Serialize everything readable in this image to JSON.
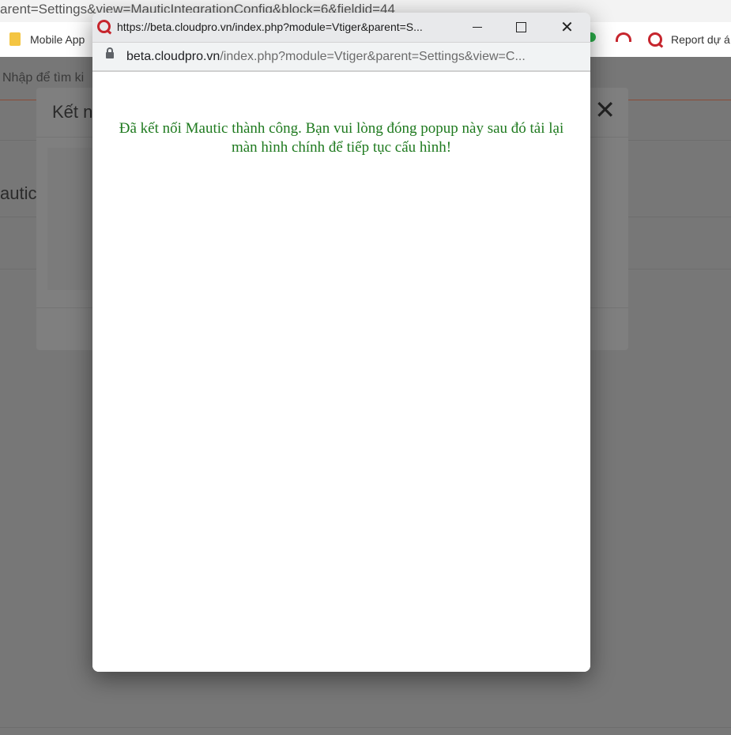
{
  "background": {
    "url_bar_text": "arent=Settings&view=MauticIntegrationConfig&block=6&fieldid=44",
    "bookmarks": [
      {
        "label": "Mobile App"
      },
      {
        "label": "Report dự á"
      }
    ],
    "search_placeholder": "Nhập để tìm ki",
    "modal_title": "Kết n",
    "modal_close": "✕",
    "page_heading": "autic"
  },
  "popup": {
    "window_title": "https://beta.cloudpro.vn/index.php?module=Vtiger&parent=S...",
    "address_domain": "beta.cloudpro.vn",
    "address_path": "/index.php?module=Vtiger&parent=Settings&view=C...",
    "close_glyph": "✕",
    "message": "Đã kết nối Mautic thành công. Bạn vui lòng đóng popup này sau đó tải lại màn hình chính để tiếp tục cấu hình!",
    "message_color": "#1f7a1f"
  }
}
